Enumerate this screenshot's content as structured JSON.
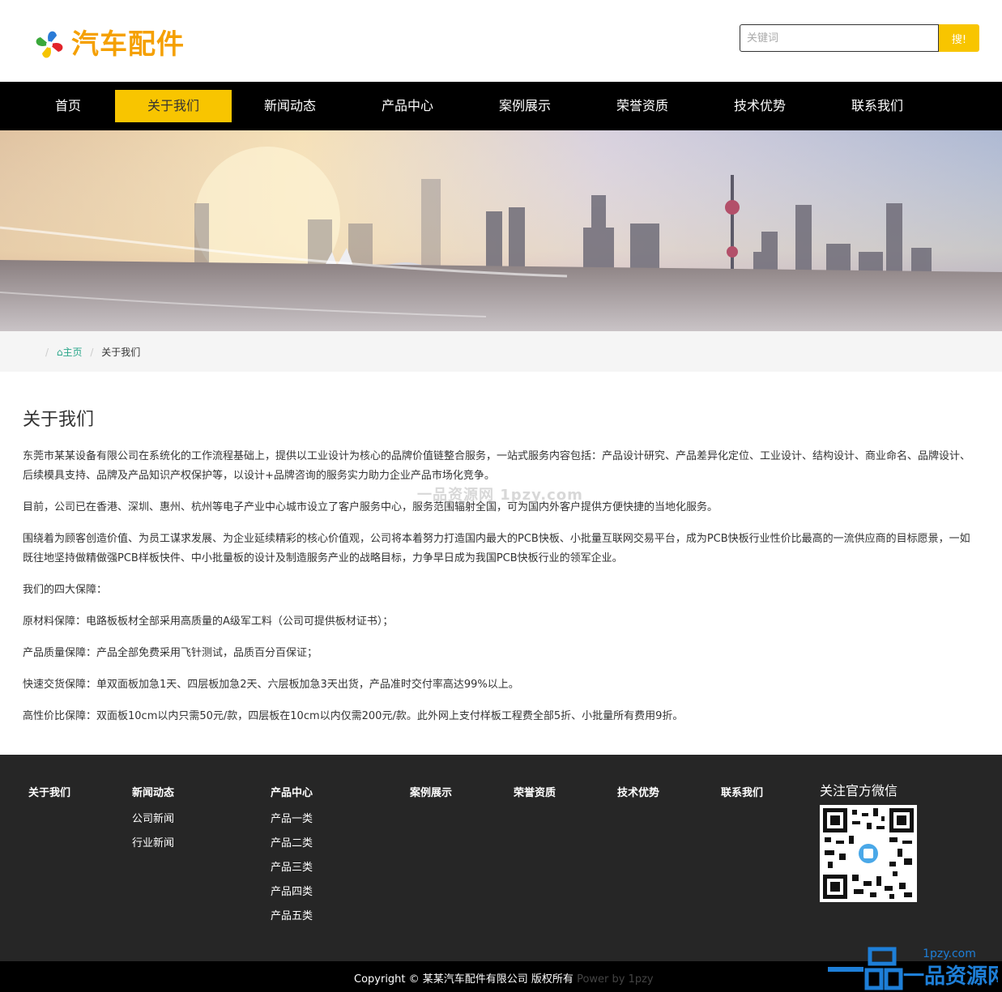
{
  "header": {
    "logo_text": "汽车配件",
    "search_placeholder": "关键词",
    "search_button": "搜!"
  },
  "nav": {
    "items": [
      {
        "label": "首页",
        "active": false
      },
      {
        "label": "关于我们",
        "active": true
      },
      {
        "label": "新闻动态",
        "active": false
      },
      {
        "label": "产品中心",
        "active": false
      },
      {
        "label": "案例展示",
        "active": false
      },
      {
        "label": "荣誉资质",
        "active": false
      },
      {
        "label": "技术优势",
        "active": false
      },
      {
        "label": "联系我们",
        "active": false
      }
    ]
  },
  "breadcrumb": {
    "home": "主页",
    "current": "关于我们"
  },
  "content": {
    "title": "关于我们",
    "paragraphs": [
      "东莞市某某设备有限公司在系统化的工作流程基础上，提供以工业设计为核心的品牌价值链整合服务，一站式服务内容包括：产品设计研究、产品差异化定位、工业设计、结构设计、商业命名、品牌设计、后续模具支持、品牌及产品知识产权保护等，以设计+品牌咨询的服务实力助力企业产品市场化竞争。",
      "目前，公司已在香港、深圳、惠州、杭州等电子产业中心城市设立了客户服务中心，服务范围辐射全国，可为国内外客户提供方便快捷的当地化服务。",
      "围绕着为顾客创造价值、为员工谋求发展、为企业延续精彩的核心价值观，公司将本着努力打造国内最大的PCB快板、小批量互联网交易平台，成为PCB快板行业性价比最高的一流供应商的目标愿景，一如既往地坚持做精做强PCB样板快件、中小批量板的设计及制造服务产业的战略目标，力争早日成为我国PCB快板行业的领军企业。",
      "我们的四大保障：",
      "原材料保障：电路板板材全部采用高质量的A级军工料（公司可提供板材证书）；",
      "产品质量保障：产品全部免费采用飞针测试，品质百分百保证；",
      "快速交货保障：单双面板加急1天、四层板加急2天、六层板加急3天出货，产品准时交付率高达99%以上。",
      "高性价比保障：双面板10cm以内只需50元/款，四层板在10cm以内仅需200元/款。此外网上支付样板工程费全部5折、小批量所有费用9折。"
    ],
    "watermark": "一品资源网 1pzy.com"
  },
  "footer": {
    "columns": [
      {
        "head": "关于我们",
        "links": []
      },
      {
        "head": "新闻动态",
        "links": [
          "公司新闻",
          "行业新闻"
        ]
      },
      {
        "head": "产品中心",
        "links": [
          "产品一类",
          "产品二类",
          "产品三类",
          "产品四类",
          "产品五类"
        ]
      },
      {
        "head": "案例展示",
        "links": []
      },
      {
        "head": "荣誉资质",
        "links": []
      },
      {
        "head": "技术优势",
        "links": []
      },
      {
        "head": "联系我们",
        "links": []
      }
    ],
    "wechat_title": "关注官方微信",
    "copyright": "Copyright © 某某汽车配件有限公司 版权所有",
    "power": "Power by 1pzy",
    "brand_url": "1pzy.com",
    "brand_name": "一品资源网"
  },
  "colors": {
    "accent": "#f8c500",
    "nav_bg": "#000000",
    "footer_bg": "#262626",
    "breadcrumb_home": "#2aa68a"
  }
}
